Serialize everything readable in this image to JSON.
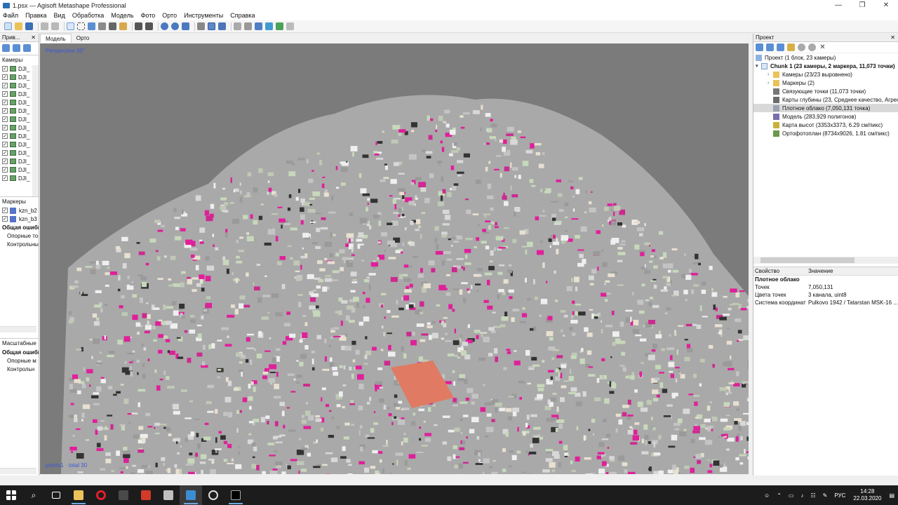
{
  "window": {
    "title": "1.psx — Agisoft Metashape Professional",
    "minimize": "—",
    "maximize": "❐",
    "close": "✕"
  },
  "menu": [
    "Файл",
    "Правка",
    "Вид",
    "Обработка",
    "Модель",
    "Фото",
    "Орто",
    "Инструменты",
    "Справка"
  ],
  "left_panel": {
    "header": "Прив...",
    "cameras_header": "Камеры",
    "cameras": [
      "DJI_",
      "DJI_",
      "DJI_",
      "DJI_",
      "DJI_",
      "DJI_",
      "DJI_",
      "DJI_",
      "DJI_",
      "DJI_",
      "DJI_",
      "DJI_",
      "DJI_",
      "DJI_"
    ],
    "markers_header": "Маркеры",
    "markers": [
      "kzn_b2",
      "kzn_b3"
    ],
    "markers_total": "Общая ошибк",
    "markers_ref": "Опорные то",
    "markers_ctrl": "Контрольны",
    "scales_header": "Масштабные",
    "scales_total": "Общая ошибк",
    "scales_ref": "Опорные м",
    "scales_ctrl": "Контрольн"
  },
  "tabs": {
    "model": "Модель",
    "ortho": "Орто"
  },
  "viewport": {
    "perspective": "Perspective 30°",
    "points_info": "points1 · total 30"
  },
  "right_panel": {
    "header": "Проект",
    "project": "Проект (1 блок, 23 камеры)",
    "chunk": "Chunk 1 (23 камеры, 2 маркера, 11,073 точки)",
    "items": [
      {
        "label": "Камеры (23/23 выровнено)",
        "icon": "folder-icon"
      },
      {
        "label": "Маркеры (2)",
        "icon": "folder-icon"
      },
      {
        "label": "Связующие точки (11,073 точки)",
        "icon": "tie-points-icon"
      },
      {
        "label": "Карты глубины (23, Среднее качество, Агрес",
        "icon": "depth-maps-icon"
      },
      {
        "label": "Плотное облако (7,050,131 точка)",
        "icon": "dense-cloud-icon"
      },
      {
        "label": "Модель (283,929 полигонов)",
        "icon": "model-icon"
      },
      {
        "label": "Карта высот (3353x3373, 6.29 см/пикс)",
        "icon": "dem-icon"
      },
      {
        "label": "Ортофотоплан (8734x9026, 1.81 см/пикс)",
        "icon": "orthomosaic-icon"
      }
    ],
    "props_headers": {
      "property": "Свойство",
      "value": "Значение"
    },
    "props_title": "Плотное облако",
    "props": [
      {
        "k": "Точек",
        "v": "7,050,131"
      },
      {
        "k": "Цвета точек",
        "v": "3 канала, uint8"
      },
      {
        "k": "Система координат",
        "v": "Pulkovo 1942 / Tatarstan MSK-16 ..."
      }
    ]
  },
  "taskbar": {
    "lang": "РУС",
    "time": "14:28",
    "date": "22.03.2020"
  },
  "colors": {
    "viewport_bg": "#7b7b7b",
    "magenta": "#e0209a",
    "accent": "#3c58d6"
  }
}
